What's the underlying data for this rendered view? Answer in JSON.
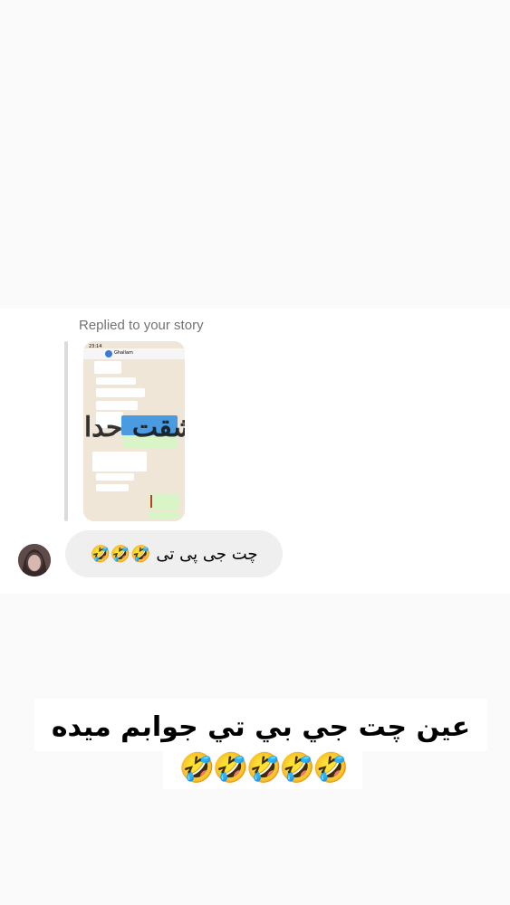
{
  "reply": {
    "label": "Replied to your story"
  },
  "story_thumbnail": {
    "time": "23:14",
    "contact_name": "Ghallam",
    "messages": [
      "به ملشعر امکانات مرستان نیست",
      "تونیک بودن امتیاز گرفتی",
      "خیلی ممنون",
      "ملشعر همه در برابر حرف میزنی چه قرانی داره",
      "نه ولیه در واقع",
      "ننفسیر تو نیست",
      "تفسیر مربستگی"
    ],
    "overlay_text": "عشقت حدا"
  },
  "message": {
    "text": "چت جی پی تی 🤣🤣🤣",
    "avatar_icon": "profile-avatar"
  },
  "caption": {
    "line1": "عین چت جي بي تي جوابم میده",
    "line2": "🤣🤣🤣🤣🤣"
  },
  "colors": {
    "bubble": "#efefef",
    "reply_label": "#737373",
    "reply_bar": "#dbdbdb",
    "background": "#fafafa"
  }
}
